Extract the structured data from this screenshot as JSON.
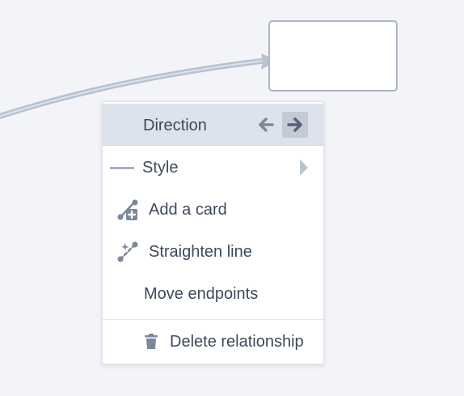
{
  "canvas": {
    "background": "#f3f4f8",
    "connector_color": "#b6c1d1",
    "card_border_color": "#aeb5c3"
  },
  "context_menu": {
    "direction": {
      "label": "Direction",
      "left_icon": "arrow-left-icon",
      "right_icon": "arrow-right-icon",
      "selected": "right"
    },
    "style": {
      "label": "Style",
      "icon": "line-style-icon",
      "submenu_icon": "chevron-right-icon"
    },
    "add_card": {
      "label": "Add a card",
      "icon": "add-card-icon"
    },
    "straighten": {
      "label": "Straighten line",
      "icon": "straighten-line-icon"
    },
    "move_endpoints": {
      "label": "Move endpoints"
    },
    "delete": {
      "label": "Delete relationship",
      "icon": "trash-icon"
    },
    "highlight_color": "#dde3ec",
    "text_color": "#3d4a5c",
    "icon_color": "#7b879a"
  }
}
